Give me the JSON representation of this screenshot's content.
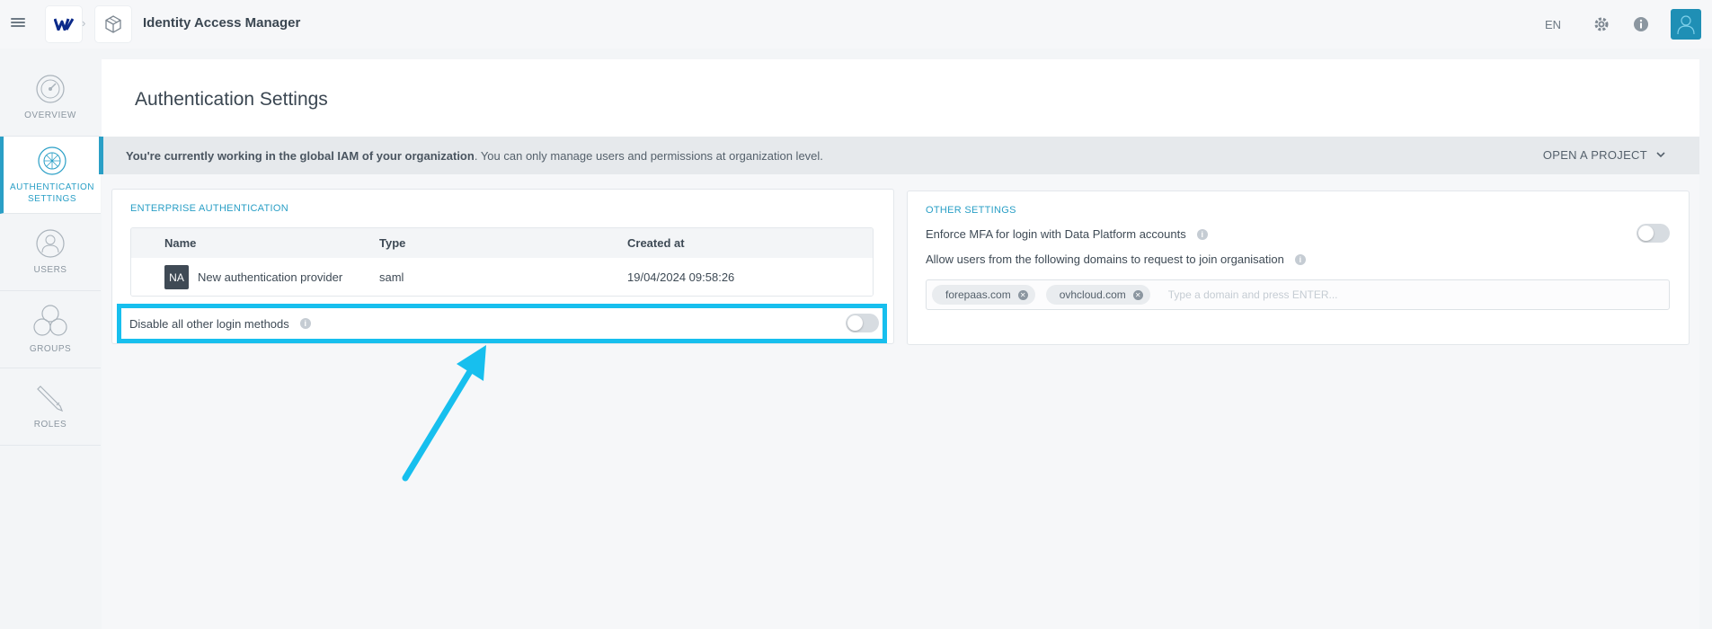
{
  "topbar": {
    "breadcrumb_separator": "›",
    "app_title": "Identity Access Manager",
    "language": "EN"
  },
  "sidebar": {
    "items": [
      {
        "label": "OVERVIEW",
        "active": false
      },
      {
        "label": "AUTHENTICATION SETTINGS",
        "active": true
      },
      {
        "label": "USERS",
        "active": false
      },
      {
        "label": "GROUPS",
        "active": false
      },
      {
        "label": "ROLES",
        "active": false
      }
    ]
  },
  "main": {
    "page_title": "Authentication Settings",
    "notice": {
      "bold": "You're currently working in the global IAM of your organization",
      "rest": ". You can only manage users and permissions at organization level.",
      "open_project": "OPEN A PROJECT"
    },
    "enterprise": {
      "title": "ENTERPRISE AUTHENTICATION",
      "columns": [
        "Name",
        "Type",
        "Created at"
      ],
      "rows": [
        {
          "badge": "NA",
          "name": "New authentication provider",
          "type": "saml",
          "created": "19/04/2024 09:58:26"
        }
      ],
      "disable_label": "Disable all other login methods",
      "disable_enabled": false
    },
    "other": {
      "title": "OTHER SETTINGS",
      "mfa_label": "Enforce MFA for login with Data Platform accounts",
      "mfa_enabled": false,
      "domains_label": "Allow users from the following domains to request to join organisation",
      "domains": [
        "forepaas.com",
        "ovhcloud.com"
      ],
      "domain_placeholder": "Type a domain and press ENTER..."
    }
  },
  "colors": {
    "accent": "#2a9fc6",
    "highlight": "#17bfee",
    "avatar": "#1f8fb5"
  }
}
